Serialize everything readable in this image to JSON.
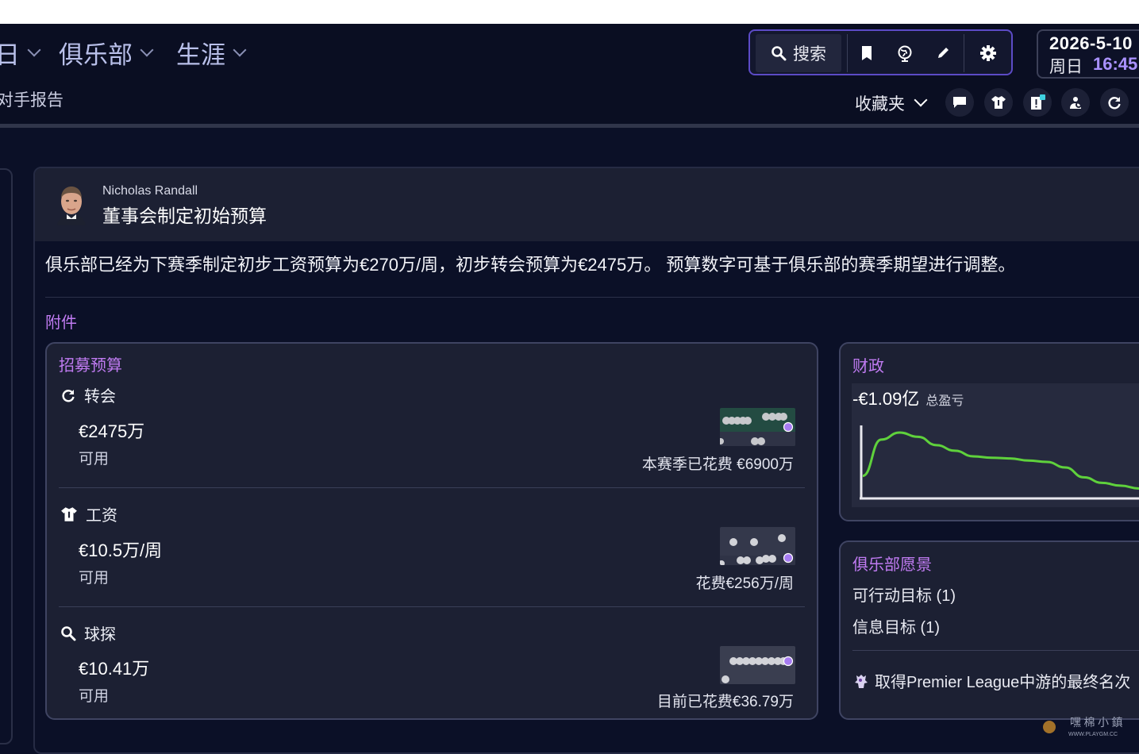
{
  "nav": {
    "items": [
      {
        "label": "日"
      },
      {
        "label": "俱乐部"
      },
      {
        "label": "生涯"
      }
    ],
    "sub_item": "对手报告"
  },
  "toolbar": {
    "search_label": "搜索",
    "icons": [
      "search-icon",
      "bookmark-icon",
      "globe-icon",
      "pencil-icon",
      "gear-icon"
    ]
  },
  "datetime": {
    "date": "2026-5-10",
    "weekday": "周日",
    "time": "16:45",
    "time_color": "#a991ff"
  },
  "favorites": {
    "label": "收藏夹",
    "icons": [
      "chat-icon",
      "shirt-icon",
      "news-icon",
      "scout-icon",
      "refresh-icon"
    ]
  },
  "message": {
    "sender": "Nicholas Randall",
    "subject": "董事会制定初始预算",
    "body": "俱乐部已经为下赛季制定初步工资预算为€270万/周，初步转会预算为€2475万。 预算数字可基于俱乐部的赛季期望进行调整。",
    "attachments_label": "附件"
  },
  "budget": {
    "title": "招募预算",
    "sections": [
      {
        "icon": "refresh-icon",
        "name": "转会",
        "amount": "€2475万",
        "status": "可用",
        "spent": "本赛季已花费 €6900万"
      },
      {
        "icon": "shirt-icon",
        "name": "工资",
        "amount": "€10.5万/周",
        "status": "可用",
        "spent": "花费€256万/周"
      },
      {
        "icon": "search-icon",
        "name": "球探",
        "amount": "€10.41万",
        "status": "可用",
        "spent": "目前已花费€36.79万"
      }
    ]
  },
  "finance": {
    "title": "财政",
    "value": "-€1.09亿",
    "label": "总盈亏",
    "line_color": "#5fd13c",
    "trend": [
      0.3,
      0.82,
      0.92,
      0.86,
      0.74,
      0.66,
      0.58,
      0.56,
      0.55,
      0.52,
      0.5,
      0.42,
      0.28,
      0.2,
      0.16,
      0.12
    ]
  },
  "vision": {
    "title": "俱乐部愿景",
    "items": [
      "可行动目标 (1)",
      "信息目标 (1)"
    ],
    "goal": "取得Premier League中游的最终名次"
  },
  "accent": "#c07bf2",
  "border_accent": "#5c4bc6"
}
